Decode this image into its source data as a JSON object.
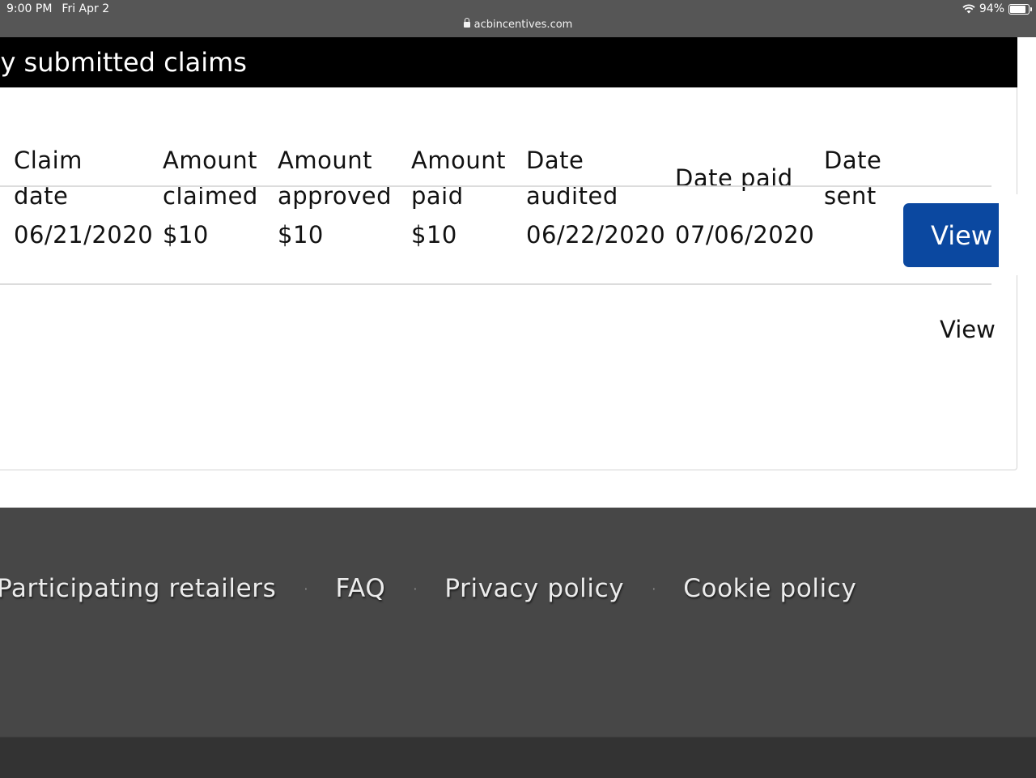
{
  "status_bar": {
    "time": "9:00 PM",
    "date": "Fri Apr 2",
    "url": "acbincentives.com",
    "battery": "94%",
    "battery_level": 0.94
  },
  "claims": {
    "title": "tly submitted claims",
    "headers": {
      "claim_date": [
        "Claim",
        "date"
      ],
      "amount_claimed": [
        "Amount",
        "claimed"
      ],
      "amount_approved": [
        "Amount",
        "approved"
      ],
      "amount_paid": [
        "Amount",
        "paid"
      ],
      "date_audited": [
        "Date",
        "audited"
      ],
      "date_paid": "Date paid",
      "date_sent": [
        "Date",
        "sent"
      ]
    },
    "row": {
      "claim_date": "06/21/2020",
      "amount_claimed": "$10",
      "amount_approved": "$10",
      "amount_paid": "$10",
      "date_audited": "06/22/2020",
      "date_paid": "07/06/2020",
      "date_sent": "",
      "view_label": "View"
    },
    "view_link": "View"
  },
  "footer": {
    "links": [
      "Participating retailers",
      "FAQ",
      "Privacy policy",
      "Cookie policy"
    ],
    "separator": "·"
  }
}
